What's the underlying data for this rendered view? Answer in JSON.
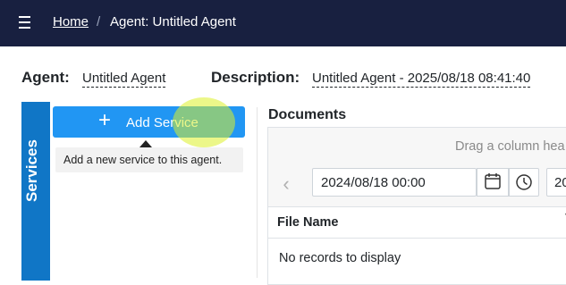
{
  "nav": {
    "home_label": "Home",
    "separator": "/",
    "current_label": "Agent: Untitled Agent"
  },
  "agent": {
    "name_label": "Agent:",
    "name_value": "Untitled Agent",
    "description_label": "Description:",
    "description_value": "Untitled Agent - 2025/08/18 08:41:40"
  },
  "services": {
    "tab_label": "Services",
    "add_button_label": "Add Service",
    "add_tooltip": "Add a new service to this agent."
  },
  "documents": {
    "title": "Documents",
    "group_panel_text": "Drag a column hea",
    "date_from": "2024/08/18 00:00",
    "date_to_partial": "20",
    "columns": [
      "File Name"
    ],
    "empty_text": "No records to display"
  },
  "colors": {
    "topbar": "#182040",
    "services_tab": "#1076c6",
    "primary_button": "#2196f3"
  }
}
